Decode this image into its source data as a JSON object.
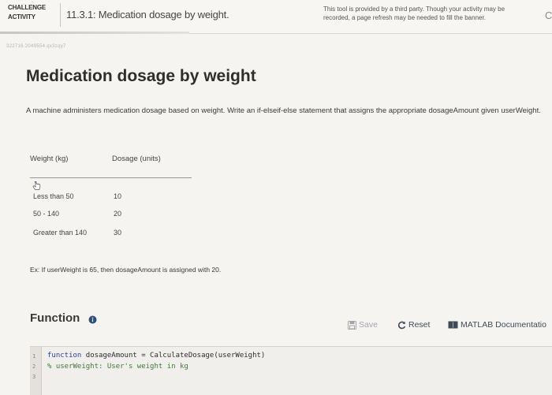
{
  "header": {
    "badge_line1": "CHALLENGE",
    "badge_line2": "ACTIVITY",
    "activity_title": "11.3.1: Medication dosage by weight.",
    "notice_line1": "This tool is provided by a third party. Though your activity may be",
    "notice_line2": "recorded, a page refresh may be needed to fill the banner.",
    "edge_char": "C"
  },
  "activity_code": "322716.2049554.qx3zqy7",
  "problem": {
    "title": "Medication dosage by weight",
    "description": "A machine administers medication dosage based on weight. Write an if-elseif-else statement that assigns the appropriate dosageAmount given userWeight."
  },
  "table": {
    "headers": [
      "Weight (kg)",
      "Dosage (units)"
    ],
    "rows": [
      {
        "weight": "Less than 50",
        "dosage": "10"
      },
      {
        "weight": "50 - 140",
        "dosage": "20"
      },
      {
        "weight": "Greater than 140",
        "dosage": "30"
      }
    ]
  },
  "example": "Ex: If userWeight is 65, then dosageAmount is assigned with 20.",
  "function_section": {
    "title": "Function",
    "save_label": "Save",
    "reset_label": "Reset",
    "matlab_label": "MATLAB Documentatio"
  },
  "editor": {
    "line_numbers": [
      "1",
      "2",
      "3"
    ],
    "lines": [
      {
        "keyword": "function",
        "rest": " dosageAmount = CalculateDosage(userWeight)"
      },
      {
        "comment": "% userWeight: User's weight in kg"
      }
    ]
  },
  "colors": {
    "accent_text": "#2e2e2e",
    "keyword": "#2a3f9e",
    "comment": "#3f7a3a",
    "save_disabled": "#9fa6ad"
  },
  "icons": [
    "info-icon",
    "save-icon",
    "reset-icon",
    "matlab-icon",
    "pointer-cursor-icon"
  ]
}
